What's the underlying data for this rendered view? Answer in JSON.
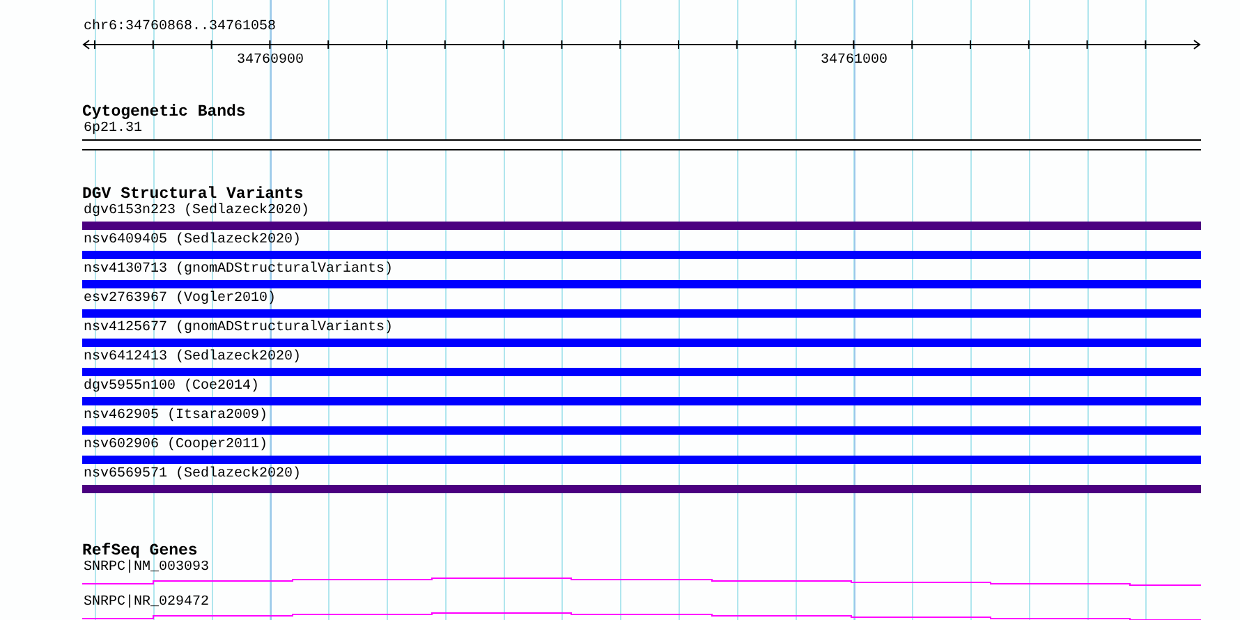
{
  "ruler": {
    "range": "chr6:34760868..34761058",
    "tick_labels": [
      "34760900",
      "34761000"
    ]
  },
  "tracks": [
    {
      "kind": "cytoband",
      "title": "Cytogenetic Bands",
      "features": [
        {
          "label": "6p21.31"
        }
      ]
    },
    {
      "kind": "variants",
      "title": "DGV Structural Variants",
      "features": [
        {
          "label": "dgv6153n223 (Sedlazeck2020)",
          "color": "#4b0080"
        },
        {
          "label": "nsv6409405 (Sedlazeck2020)",
          "color": "#0000ff"
        },
        {
          "label": "nsv4130713 (gnomADStructuralVariants)",
          "color": "#0000ff"
        },
        {
          "label": "esv2763967 (Vogler2010)",
          "color": "#0000ff"
        },
        {
          "label": "nsv4125677 (gnomADStructuralVariants)",
          "color": "#0000ff"
        },
        {
          "label": "nsv6412413 (Sedlazeck2020)",
          "color": "#0000ff"
        },
        {
          "label": "dgv5955n100 (Coe2014)",
          "color": "#0000ff"
        },
        {
          "label": "nsv462905 (Itsara2009)",
          "color": "#0000ff"
        },
        {
          "label": "nsv602906 (Cooper2011)",
          "color": "#0000ff"
        },
        {
          "label": "nsv6569571 (Sedlazeck2020)",
          "color": "#4b0080"
        }
      ]
    },
    {
      "kind": "genes",
      "title": "RefSeq Genes",
      "features": [
        {
          "label": "SNRPC|NM_003093"
        },
        {
          "label": "SNRPC|NR_029472"
        }
      ]
    }
  ]
}
